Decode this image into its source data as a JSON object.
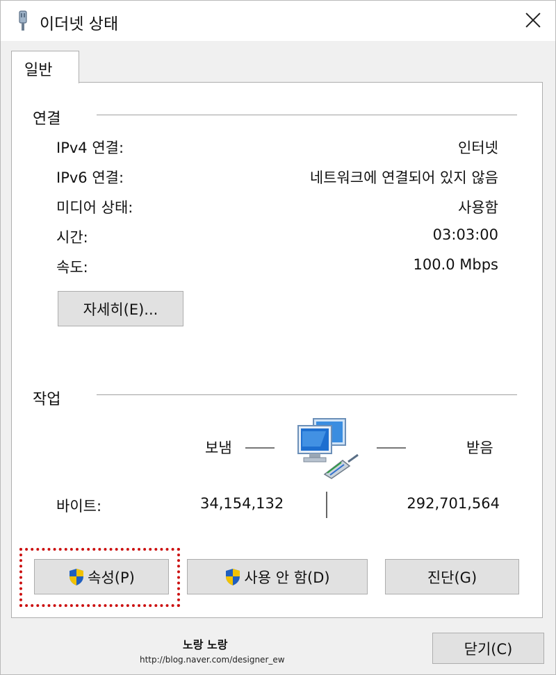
{
  "window": {
    "title": "이더넷 상태",
    "close_icon": "close-icon"
  },
  "tabs": [
    {
      "label": "일반"
    }
  ],
  "connection": {
    "group_title": "연결",
    "rows": [
      {
        "label": "IPv4 연결:",
        "value": "인터넷"
      },
      {
        "label": "IPv6 연결:",
        "value": "네트워크에 연결되어 있지 않음"
      },
      {
        "label": "미디어 상태:",
        "value": "사용함"
      },
      {
        "label": "시간:",
        "value": "03:03:00"
      },
      {
        "label": "속도:",
        "value": "100.0 Mbps"
      }
    ],
    "details_button": "자세히(E)..."
  },
  "activity": {
    "group_title": "작업",
    "sent_label": "보냄",
    "received_label": "받음",
    "bytes_label": "바이트:",
    "bytes_sent": "34,154,132",
    "bytes_received": "292,701,564",
    "network_icon": "network-computers-icon"
  },
  "buttons": {
    "properties": "속성(P)",
    "disable": "사용 안 함(D)",
    "diagnose": "진단(G)",
    "close": "닫기(C)"
  },
  "watermark": {
    "title": "노랑 노랑",
    "url": "http://blog.naver.com/designer_ew"
  },
  "colors": {
    "highlight": "#cc1111",
    "shield_blue": "#1f5fbf",
    "shield_yellow": "#f2c200"
  }
}
